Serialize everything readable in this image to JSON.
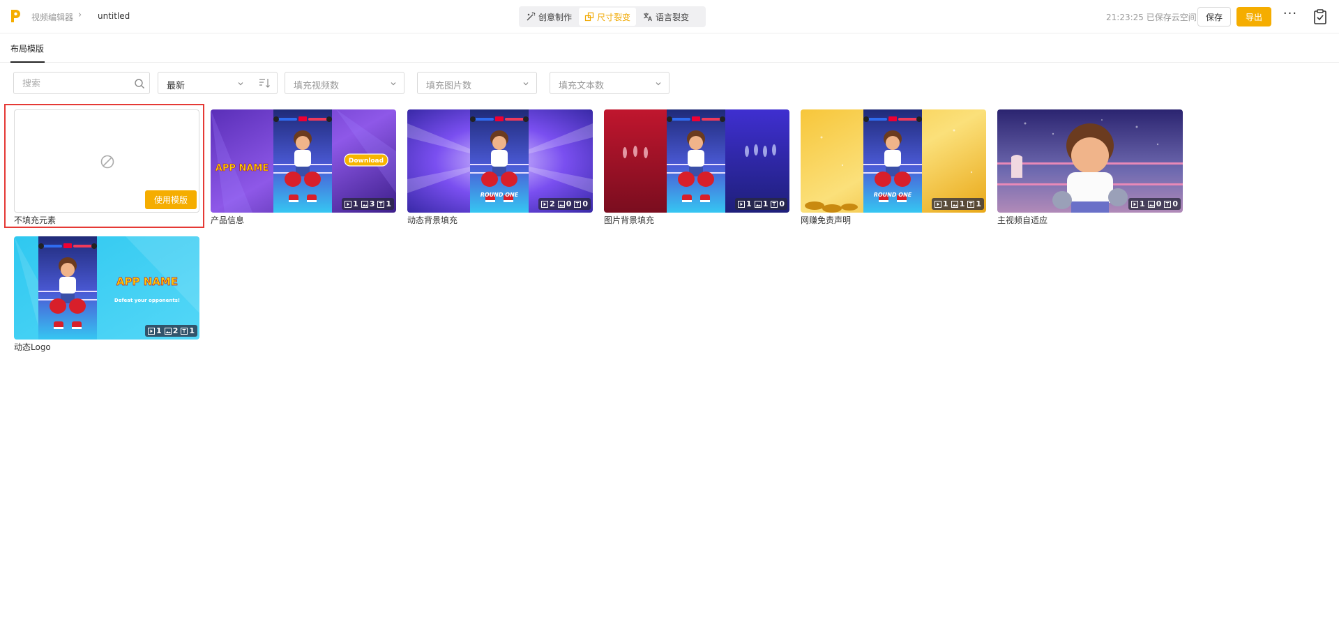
{
  "header": {
    "app_name": "视频编辑器",
    "file_name": "untitled",
    "modes": [
      {
        "label": "创意制作",
        "active": false,
        "icon": "magic-wand-icon"
      },
      {
        "label": "尺寸裂变",
        "active": true,
        "icon": "resize-icon"
      },
      {
        "label": "语言裂变",
        "active": false,
        "icon": "translate-icon"
      }
    ],
    "save_status": "21:23:25 已保存云空间",
    "save_label": "保存",
    "export_label": "导出",
    "more_label": "···"
  },
  "tabs": [
    {
      "label": "布局模版",
      "active": true
    }
  ],
  "filters": {
    "search_placeholder": "搜索",
    "sort_value": "最新",
    "video_placeholder": "填充视频数",
    "image_placeholder": "填充图片数",
    "text_placeholder": "填充文本数"
  },
  "templates": [
    {
      "name": "不填充元素",
      "empty": true,
      "use_label": "使用模版"
    },
    {
      "name": "产品信息",
      "videos": "1",
      "images": "3",
      "texts": "1"
    },
    {
      "name": "动态背景填充",
      "videos": "2",
      "images": "0",
      "texts": "0"
    },
    {
      "name": "图片背景填充",
      "videos": "1",
      "images": "1",
      "texts": "0"
    },
    {
      "name": "网赚免责声明",
      "videos": "1",
      "images": "1",
      "texts": "1"
    },
    {
      "name": "主视频自适应",
      "videos": "1",
      "images": "0",
      "texts": "0"
    },
    {
      "name": "动态Logo",
      "videos": "1",
      "images": "2",
      "texts": "1"
    }
  ],
  "thumb_text": {
    "app_name": "APP NAME",
    "download": "Download",
    "round_one": "ROUND ONE",
    "tagline": "Defeat your opponents!"
  },
  "colors": {
    "accent": "#f5ad00",
    "selection": "#e53935"
  }
}
